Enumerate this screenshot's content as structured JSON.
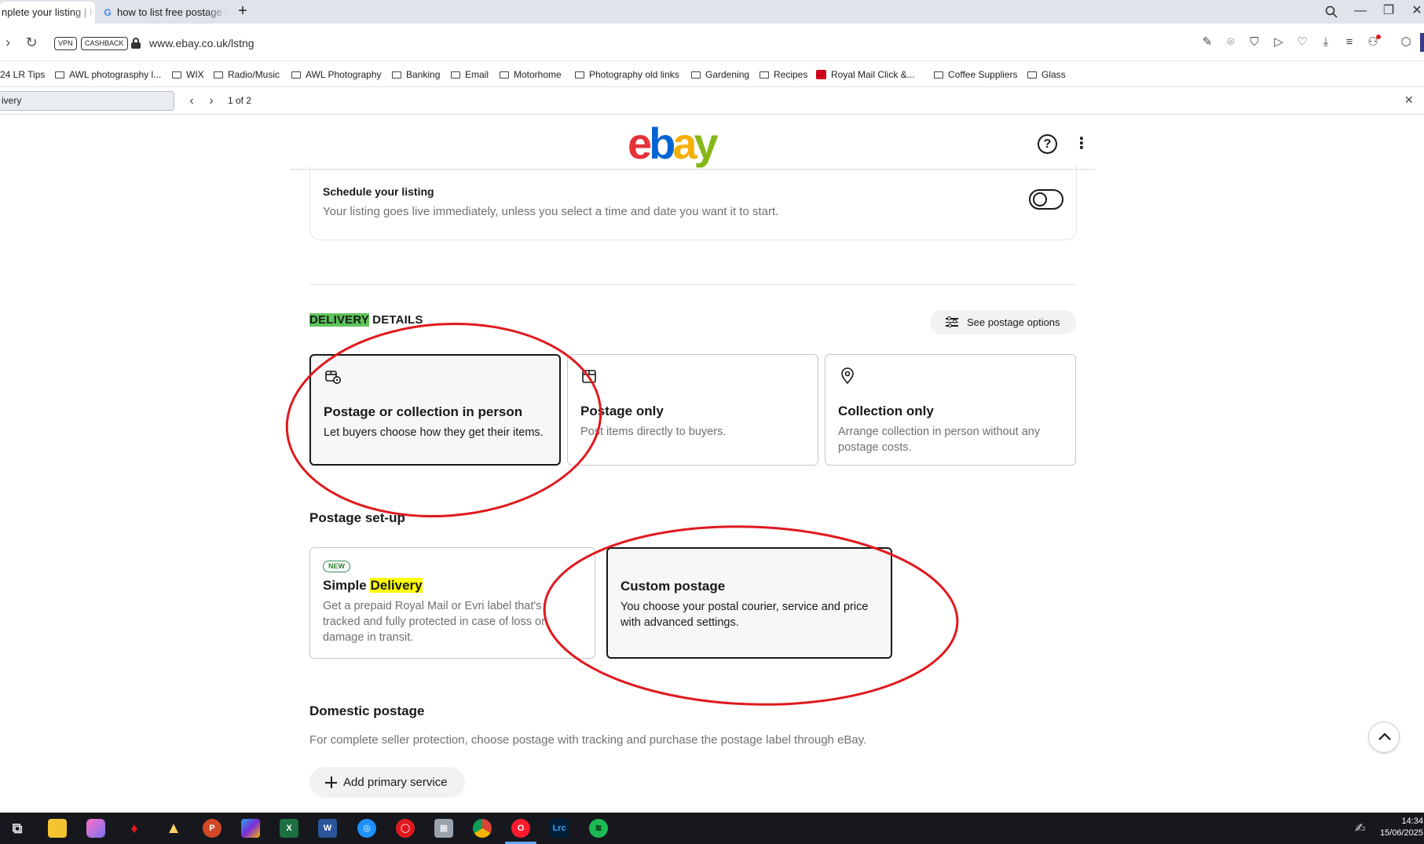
{
  "browser": {
    "tabs": [
      {
        "label": "nplete your listing | Kn"
      },
      {
        "label": "how to list free postage o"
      }
    ],
    "vpn_label": "VPN",
    "cashback_label": "CASHBACK",
    "url": "www.ebay.co.uk/lstng",
    "bookmarks": [
      "24 LR Tips",
      "AWL photograsphy l...",
      "WIX",
      "Radio/Music",
      "AWL Photography",
      "Banking",
      "Email",
      "Motorhome",
      "Photography old links",
      "Gardening",
      "Recipes",
      "Royal Mail Click &...",
      "Coffee Suppliers",
      "Glass"
    ],
    "find": {
      "query": "ivery",
      "count": "1 of 2"
    }
  },
  "ebay": {
    "logo_letters": [
      "e",
      "b",
      "a",
      "y"
    ],
    "colors": {
      "logo_e": "#e53238",
      "logo_b": "#0064d2",
      "logo_a": "#f5af02",
      "logo_y": "#86b817",
      "annotation_red": "#e0191e",
      "highlight_green": "#5cc45a",
      "highlight_yellow": "#ffff00"
    },
    "schedule": {
      "title": "Schedule your listing",
      "description": "Your listing goes live immediately, unless you select a time and date you want it to start."
    },
    "delivery": {
      "heading_highlight": "DELIVERY",
      "heading_rest": " DETAILS",
      "see_postage_label": "See postage options",
      "options": [
        {
          "title": "Postage or collection in person",
          "description": "Let buyers choose how they get their items.",
          "icon": "package-pin-icon"
        },
        {
          "title": "Postage only",
          "description": "Post items directly to buyers.",
          "icon": "package-icon"
        },
        {
          "title": "Collection only",
          "description": "Arrange collection in person without any postage costs.",
          "icon": "location-pin-icon"
        }
      ]
    },
    "postage_setup": {
      "heading": "Postage set-up",
      "simple": {
        "badge": "NEW",
        "title_plain": "Simple ",
        "title_highlight": "Delivery",
        "description": "Get a prepaid Royal Mail or Evri label that's tracked and fully protected in case of loss or damage in transit."
      },
      "custom": {
        "title": "Custom postage",
        "description": "You choose your postal courier, service and price with advanced settings."
      }
    },
    "domestic": {
      "heading": "Domestic postage",
      "description": "For complete seller protection, choose postage with tracking and purchase the postage label through eBay.",
      "add_service_label": "Add primary service"
    }
  },
  "taskbar": {
    "apps": [
      "task-view",
      "file-explorer",
      "photos",
      "app-red",
      "affinity",
      "powerpoint",
      "m365",
      "excel",
      "word",
      "app-blue",
      "app-red-circle",
      "calculator",
      "chrome",
      "opera",
      "lightroom",
      "spotify"
    ],
    "lightroom_label": "Lrc",
    "time": "14:34",
    "date": "15/06/2025"
  }
}
